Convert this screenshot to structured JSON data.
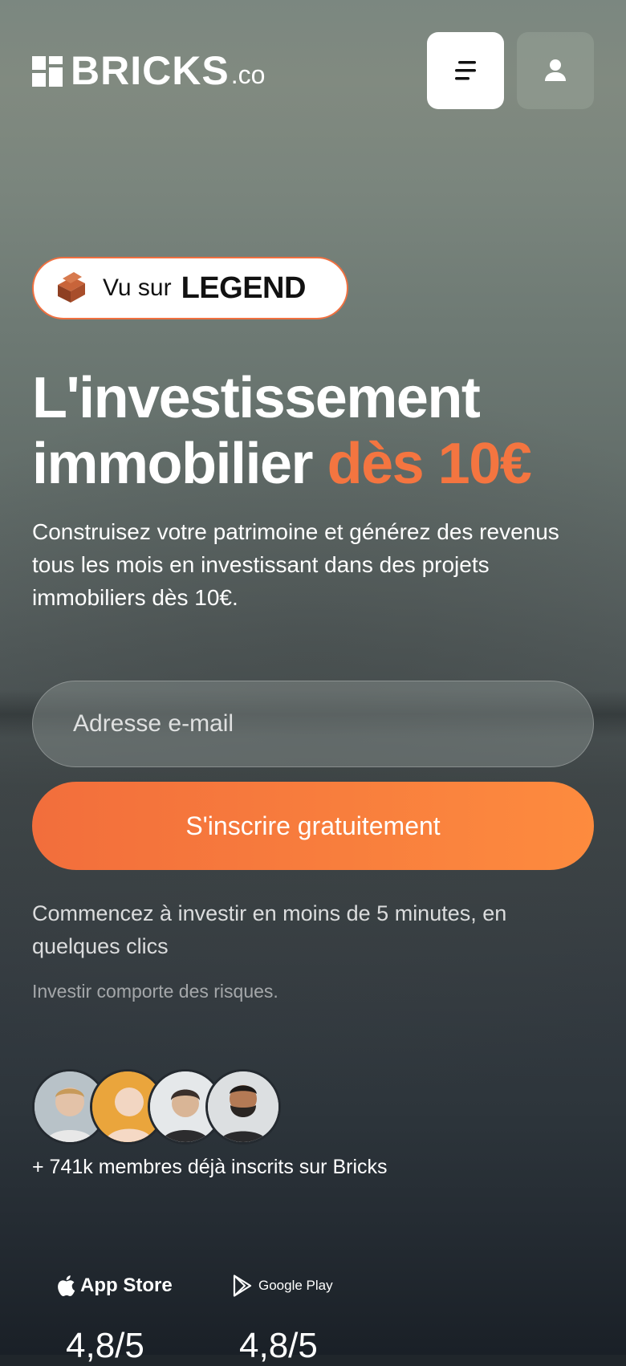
{
  "header": {
    "logo_text": "BRICKS",
    "logo_tld": ".co",
    "menu_icon": "menu-icon",
    "user_icon": "user-icon"
  },
  "badge": {
    "prefix": "Vu sur",
    "brand": "LEGEND",
    "icon": "brick-icon"
  },
  "hero": {
    "headline_line1": "L'investissement",
    "headline_line2": "immobilier",
    "headline_accent": "dès 10€",
    "subtext": "Construisez votre patrimoine et générez des revenus tous les mois en investissant dans des projets immobiliers dès 10€."
  },
  "form": {
    "email_placeholder": "Adresse e-mail",
    "email_value": "",
    "cta_label": "S'inscrire gratuitement"
  },
  "note": "Commencez à investir en moins de 5 minutes, en quelques clics",
  "risk": "Investir comporte des risques.",
  "community": {
    "members_text": "+ 741k membres déjà inscrits sur Bricks",
    "avatar_count": 4
  },
  "stores": [
    {
      "name": "App Store",
      "icon": "apple-icon",
      "rating": "4,8/5"
    },
    {
      "name": "Google Play",
      "icon": "google-play-icon",
      "rating": "4,8/5"
    }
  ],
  "colors": {
    "accent": "#f47540",
    "cta_start": "#f26e3c",
    "cta_end": "#fd8b3e"
  }
}
